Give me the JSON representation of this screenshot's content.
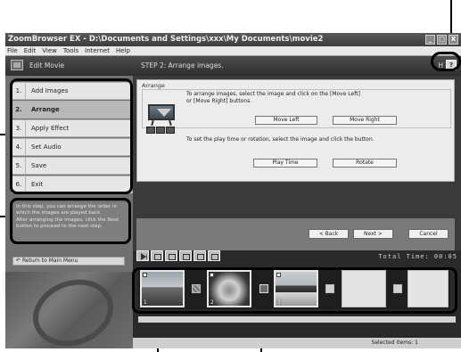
{
  "window": {
    "title": "ZoomBrowser EX  -  D:\\Documents and Settings\\xxx\\My Documents\\movie2",
    "controls": [
      "_",
      "□",
      "X"
    ]
  },
  "menu": [
    "File",
    "Edit",
    "View",
    "Tools",
    "Internet",
    "Help"
  ],
  "header": {
    "title": "Edit Movie",
    "step": "STEP 2: Arrange images.",
    "help_label": "H",
    "help_button": "?"
  },
  "steps": [
    {
      "num": "1.",
      "label": "Add Images"
    },
    {
      "num": "2.",
      "label": "Arrange"
    },
    {
      "num": "3.",
      "label": "Apply Effect"
    },
    {
      "num": "4.",
      "label": "Set Audio"
    },
    {
      "num": "5.",
      "label": "Save"
    },
    {
      "num": "6.",
      "label": "Exit"
    }
  ],
  "active_step": 1,
  "info": {
    "line1": "In this step, you can arrange the order in which the images are played back.",
    "line2": "After arranging the images, click the Next button to proceed to the next step."
  },
  "return_button": "Return to Main Menu",
  "arrange": {
    "label": "Arrange",
    "instruction1": "To arrange images, select the image and click on the [Move Left] or [Move Right] buttons.",
    "move_left": "Move Left",
    "move_right": "Move Right",
    "instruction2": "To set the play time or rotation, select the image and click the button.",
    "play_time": "Play Time",
    "rotate": "Rotate"
  },
  "nav": {
    "back": "< Back",
    "next": "Next >",
    "cancel": "Cancel"
  },
  "timeline": {
    "total_time": "Total Time: 00:05",
    "slots": [
      {
        "n": "1",
        "image": "landscape"
      },
      {
        "n": "2",
        "image": "flower"
      },
      {
        "n": "3",
        "image": "building"
      },
      {
        "n": "",
        "image": "empty"
      },
      {
        "n": "",
        "image": "empty"
      }
    ]
  },
  "status": {
    "selected": "Selected Items: 1"
  },
  "icons": [
    "edit-movie-icon",
    "help-icon",
    "return-icon",
    "play-icon",
    "timeline-tool-icon",
    "easel-icon"
  ]
}
